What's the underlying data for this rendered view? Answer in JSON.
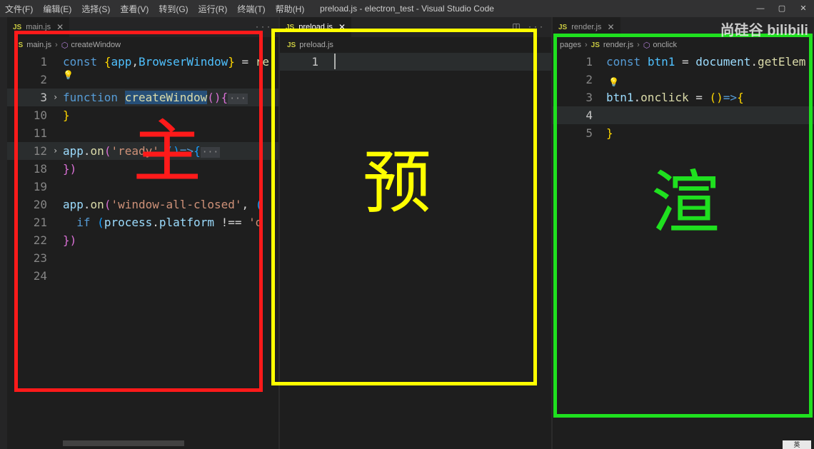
{
  "titlebar": {
    "menus": [
      "文件(F)",
      "编辑(E)",
      "选择(S)",
      "查看(V)",
      "转到(G)",
      "运行(R)",
      "终端(T)",
      "帮助(H)"
    ],
    "title": "preload.js - electron_test - Visual Studio Code",
    "btn_min": "—",
    "btn_max": "▢",
    "btn_close": "✕"
  },
  "left": {
    "tab_label": "main.js",
    "breadcrumb_file": "main.js",
    "breadcrumb_symbol": "createWindow"
  },
  "middle": {
    "tab_label": "preload.js",
    "breadcrumb_file": "preload.js"
  },
  "right": {
    "tab_label": "render.js",
    "breadcrumb_folder": "pages",
    "breadcrumb_file": "render.js",
    "breadcrumb_symbol": "onclick"
  },
  "annotations": {
    "red_char": "主",
    "yellow_char": "预",
    "green_char": "渲"
  },
  "watermark": "尚硅谷 bilibili",
  "ime": "英"
}
